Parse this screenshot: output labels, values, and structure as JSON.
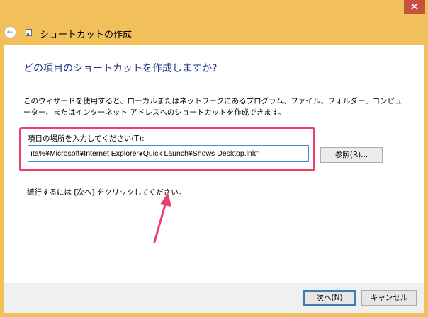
{
  "window": {
    "close_glyph": "✕",
    "accent": "#f2c05a"
  },
  "nav": {
    "back_glyph": "←",
    "title": "ショートカットの作成"
  },
  "wizard": {
    "heading": "どの項目のショートカットを作成しますか?",
    "description": "このウィザードを使用すると、ローカルまたはネットワークにあるプログラム、ファイル、フォルダー、コンピューター、またはインターネット アドレスへのショートカットを作成できます。",
    "field_label": "項目の場所を入力してください(T):",
    "location_value": "ıta%¥Microsoft¥Internet Explorer¥Quick Launch¥Shows Desktop.lnk\"",
    "browse_label": "参照(R)...",
    "hint": "続行するには [次へ] をクリックしてください。",
    "highlight_color": "#ec3f6d"
  },
  "footer": {
    "next_label": "次へ(N)",
    "cancel_label": "キャンセル"
  }
}
